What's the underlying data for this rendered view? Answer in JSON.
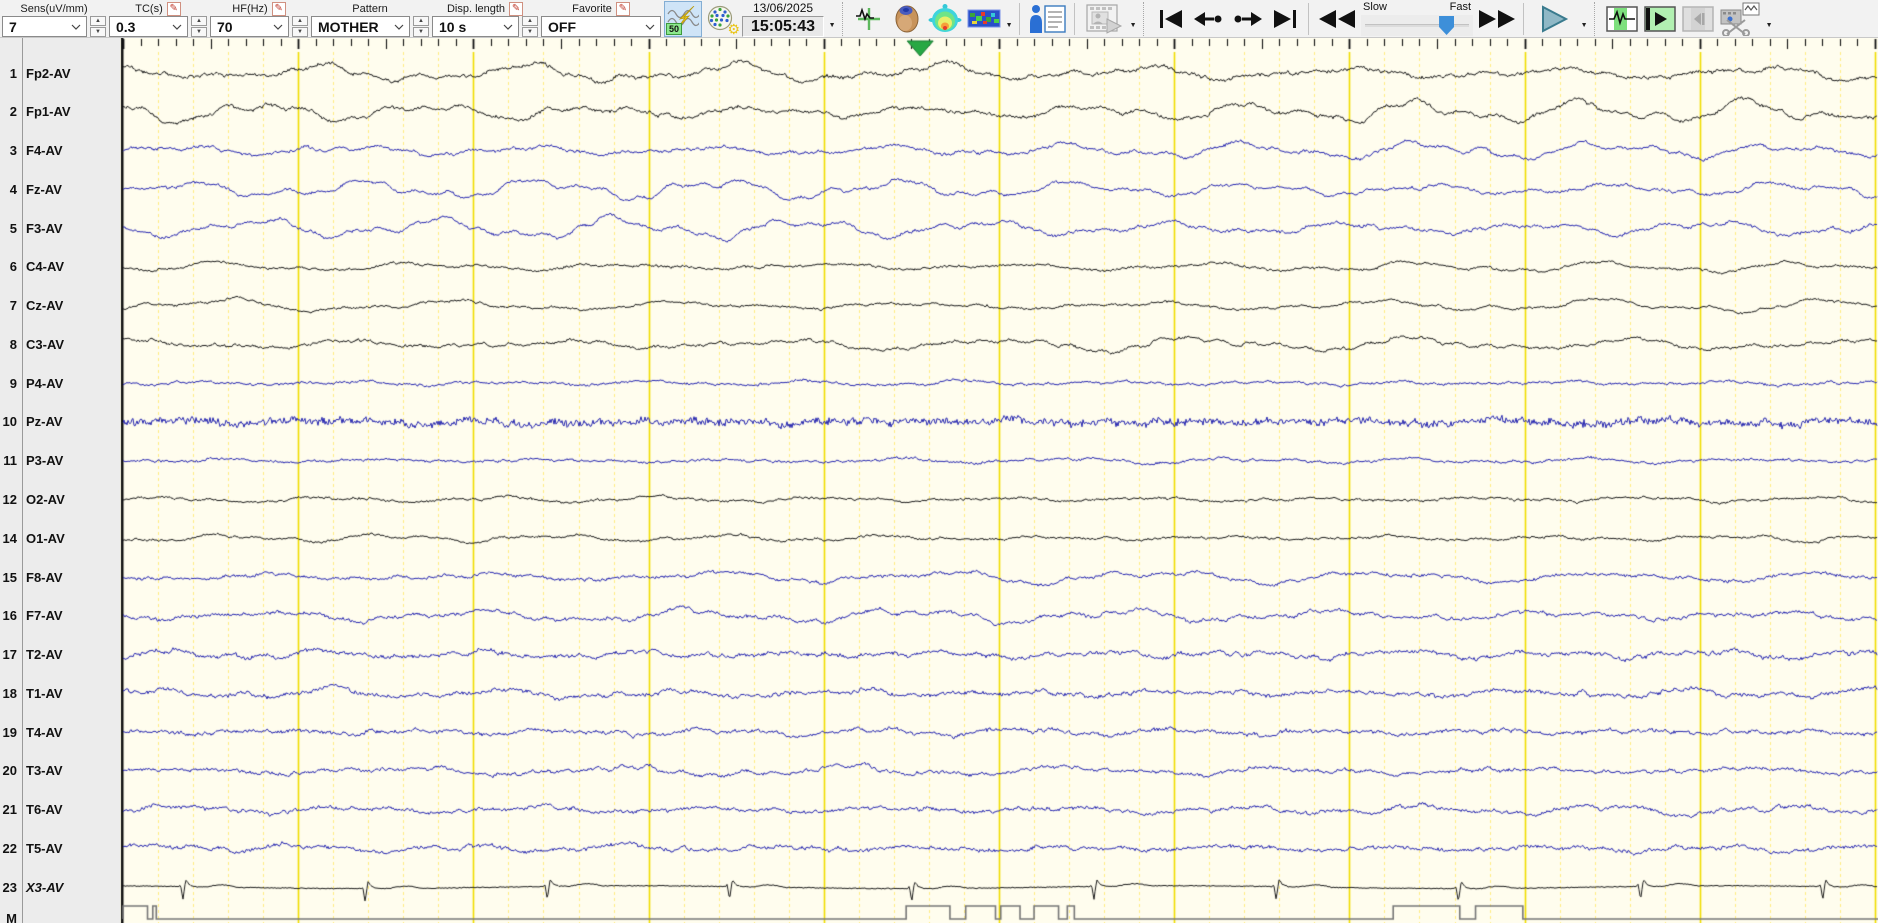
{
  "toolbar": {
    "combos": [
      {
        "label": "Sens(uV/mm)",
        "value": "7",
        "pencil": false,
        "spinner": true
      },
      {
        "label": "TC(s)",
        "value": "0.3",
        "pencil": true,
        "spinner": true
      },
      {
        "label": "HF(Hz)",
        "value": "70",
        "pencil": true,
        "spinner": true
      },
      {
        "label": "Pattern",
        "value": "MOTHER",
        "pencil": false,
        "spinner": true
      },
      {
        "label": "Disp. length",
        "value": "10 s",
        "pencil": true,
        "spinner": true
      },
      {
        "label": "Favorite",
        "value": "OFF",
        "pencil": true,
        "spinner": false
      }
    ],
    "notch_badge_label": "50",
    "date": "13/06/2025",
    "time": "15:05:43",
    "speed": {
      "slow_label": "Slow",
      "fast_label": "Fast"
    }
  },
  "colors": {
    "canvas_bg": "#fffdee",
    "grid_solid": "#f0de00",
    "grid_dashed": "#ffec80",
    "trace_black": "#1a1a1a",
    "trace_blue": "#2525b0",
    "marker_green": "#27a844",
    "marker_channel": "#777777",
    "tick": "#111111"
  },
  "display": {
    "seconds_per_page": 10,
    "event_marker_time_s": 4.55
  },
  "channels": [
    {
      "num": "1",
      "label": "Fp2-AV",
      "color": "black",
      "amp": 12,
      "noise": 2.2,
      "f": 1.0
    },
    {
      "num": "2",
      "label": "Fp1-AV",
      "color": "black",
      "amp": 14,
      "noise": 2.2,
      "f": 0.95
    },
    {
      "num": "3",
      "label": "F4-AV",
      "color": "blue",
      "amp": 10,
      "noise": 2.0,
      "f": 1.05
    },
    {
      "num": "4",
      "label": "Fz-AV",
      "color": "blue",
      "amp": 13,
      "noise": 1.8,
      "f": 0.9
    },
    {
      "num": "5",
      "label": "F3-AV",
      "color": "blue",
      "amp": 13,
      "noise": 2.0,
      "f": 0.95
    },
    {
      "num": "6",
      "label": "C4-AV",
      "color": "black",
      "amp": 6.5,
      "noise": 1.6,
      "f": 1.0
    },
    {
      "num": "7",
      "label": "Cz-AV",
      "color": "black",
      "amp": 8,
      "noise": 1.5,
      "f": 0.85
    },
    {
      "num": "8",
      "label": "C3-AV",
      "color": "black",
      "amp": 9,
      "noise": 1.8,
      "f": 0.9
    },
    {
      "num": "9",
      "label": "P4-AV",
      "color": "blue",
      "amp": 3.2,
      "noise": 1.6,
      "f": 1.2
    },
    {
      "num": "10",
      "label": "Pz-AV",
      "color": "blue",
      "amp": 2.8,
      "noise": 3.0,
      "f": 1.2,
      "fuzzy": true
    },
    {
      "num": "11",
      "label": "P3-AV",
      "color": "blue",
      "amp": 3.4,
      "noise": 1.6,
      "f": 1.1
    },
    {
      "num": "12",
      "label": "O2-AV",
      "color": "black",
      "amp": 3.8,
      "noise": 1.5,
      "f": 1.0
    },
    {
      "num": "14",
      "label": "O1-AV",
      "color": "black",
      "amp": 4.5,
      "noise": 1.5,
      "f": 0.95
    },
    {
      "num": "15",
      "label": "F8-AV",
      "color": "blue",
      "amp": 8.5,
      "noise": 2.0,
      "f": 0.9
    },
    {
      "num": "16",
      "label": "F7-AV",
      "color": "blue",
      "amp": 9,
      "noise": 2.2,
      "f": 0.85
    },
    {
      "num": "17",
      "label": "T2-AV",
      "color": "blue",
      "amp": 6,
      "noise": 2.6,
      "f": 1.0
    },
    {
      "num": "18",
      "label": "T1-AV",
      "color": "blue",
      "amp": 6,
      "noise": 2.6,
      "f": 1.0
    },
    {
      "num": "19",
      "label": "T4-AV",
      "color": "blue",
      "amp": 4.5,
      "noise": 2.4,
      "f": 1.1
    },
    {
      "num": "20",
      "label": "T3-AV",
      "color": "blue",
      "amp": 6.5,
      "noise": 2.2,
      "f": 0.9
    },
    {
      "num": "21",
      "label": "T6-AV",
      "color": "blue",
      "amp": 5.5,
      "noise": 2.4,
      "f": 1.05
    },
    {
      "num": "22",
      "label": "T5-AV",
      "color": "blue",
      "amp": 5,
      "noise": 2.4,
      "f": 1.0
    },
    {
      "num": "23",
      "label": "X3-AV",
      "color": "black",
      "type": "ecg",
      "italic": true
    }
  ],
  "marker_channel": {
    "label": "M",
    "pulses_s": [
      [
        0,
        0.14
      ],
      [
        0.17,
        0.19
      ],
      [
        4.47,
        4.72
      ],
      [
        4.81,
        4.98
      ],
      [
        5.01,
        5.12
      ],
      [
        5.2,
        5.34
      ],
      [
        5.39,
        5.43
      ],
      [
        7.25,
        7.63
      ],
      [
        7.72,
        7.99
      ]
    ]
  }
}
